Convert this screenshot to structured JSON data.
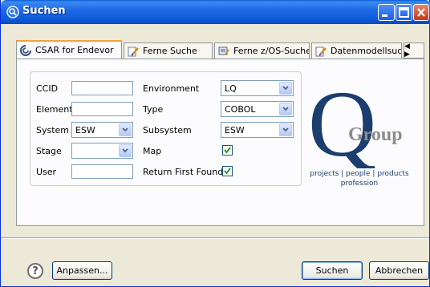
{
  "window": {
    "title": "Suchen"
  },
  "tabs": [
    {
      "label": "CSAR for Endevor",
      "active": true
    },
    {
      "label": "Ferne Suche"
    },
    {
      "label": "Ferne z/OS-Suche"
    },
    {
      "label": "Datenmodellsuche"
    }
  ],
  "tab_scroll": "◀ ▶",
  "form": {
    "ccid_label": "CCID",
    "ccid_value": "",
    "element_label": "Element",
    "element_value": "",
    "system_label": "System",
    "system_value": "ESW",
    "stage_label": "Stage",
    "stage_value": "",
    "user_label": "User",
    "user_value": "",
    "environment_label": "Environment",
    "environment_value": "LQ",
    "type_label": "Type",
    "type_value": "COBOL",
    "subsystem_label": "Subsystem",
    "subsystem_value": "ESW",
    "map_label": "Map",
    "map_checked": true,
    "return_first_label": "Return First Found",
    "return_first_checked": true
  },
  "logo": {
    "q_letter": "Q",
    "group_text": "Group",
    "line1": "projects | people | products",
    "line2": "profession"
  },
  "footer": {
    "help": "?",
    "customize_label": "Anpassen...",
    "search_label": "Suchen",
    "cancel_label": "Abbrechen"
  },
  "colors": {
    "titlebar": "#0b55d4",
    "logo_blue": "#1b3e6e",
    "logo_gray": "#8c8c8c",
    "active_tab_accent": "#f2a33a"
  }
}
